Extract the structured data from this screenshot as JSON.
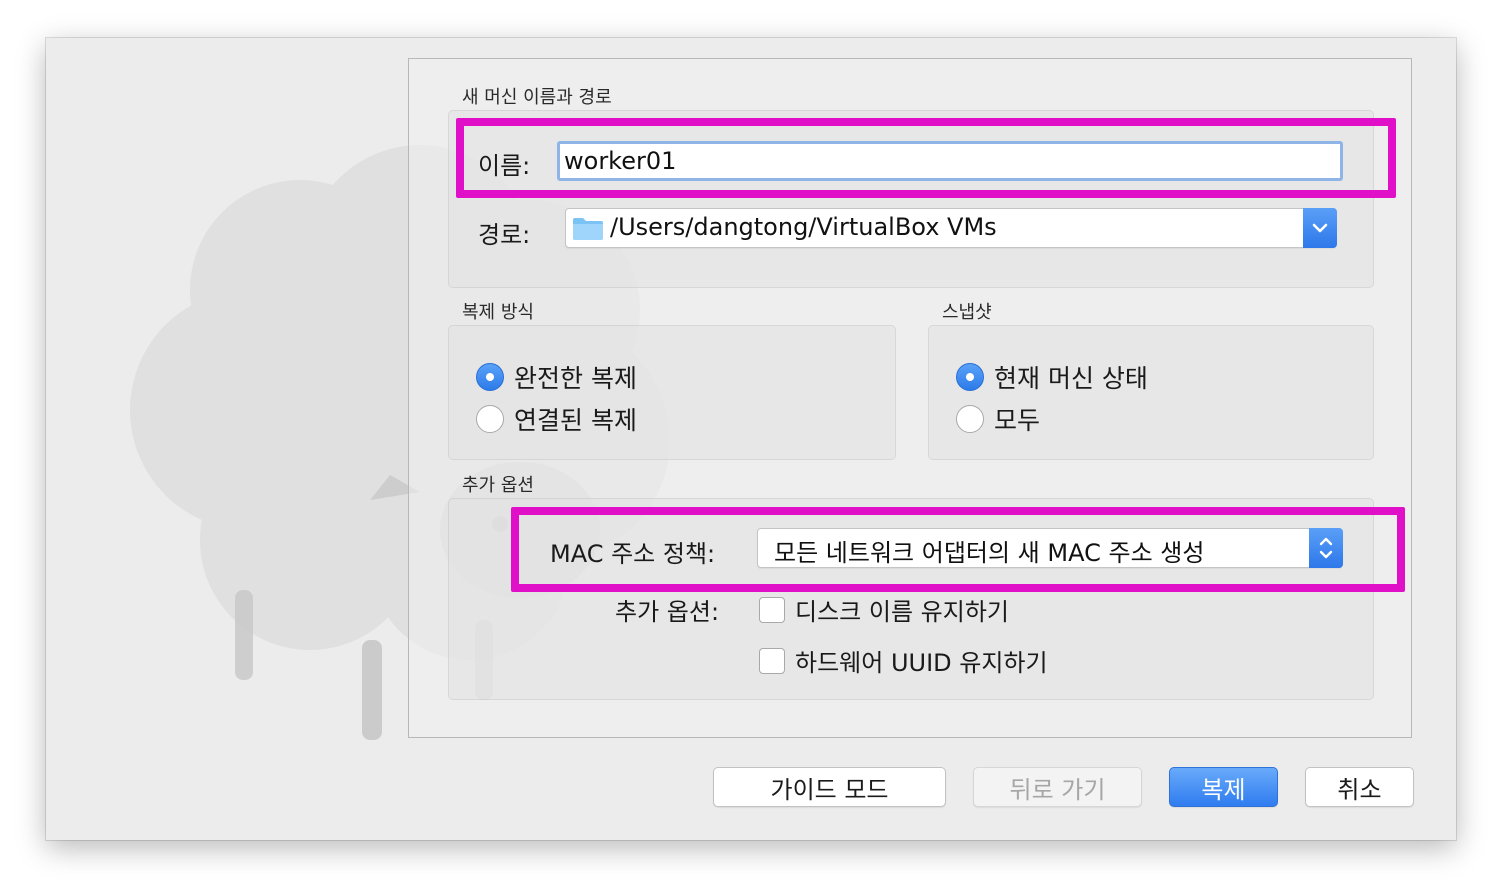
{
  "name_path": {
    "section_title": "새 머신 이름과 경로",
    "name_label": "이름:",
    "name_value": "worker01",
    "path_label": "경로:",
    "path_value": "/Users/dangtong/VirtualBox VMs",
    "path_icon": "folder-icon"
  },
  "clone_type": {
    "section_title": "복제 방식",
    "options": [
      {
        "label": "완전한 복제",
        "selected": true
      },
      {
        "label": "연결된 복제",
        "selected": false
      }
    ]
  },
  "snapshots": {
    "section_title": "스냅샷",
    "options": [
      {
        "label": "현재 머신 상태",
        "selected": true
      },
      {
        "label": "모두",
        "selected": false
      }
    ]
  },
  "additional": {
    "section_title": "추가 옵션",
    "mac_label": "MAC 주소 정책:",
    "mac_value": "모든 네트워크 어댑터의 새 MAC 주소 생성",
    "options_label": "추가 옵션:",
    "checkboxes": [
      {
        "label": "디스크 이름 유지하기",
        "checked": false
      },
      {
        "label": "하드웨어 UUID 유지하기",
        "checked": false
      }
    ]
  },
  "buttons": {
    "guided": "가이드 모드",
    "back": "뒤로 가기",
    "clone": "복제",
    "cancel": "취소"
  },
  "colors": {
    "accent": "#2f7cf0",
    "highlight": "#e010c8",
    "window_bg": "#ececec"
  }
}
